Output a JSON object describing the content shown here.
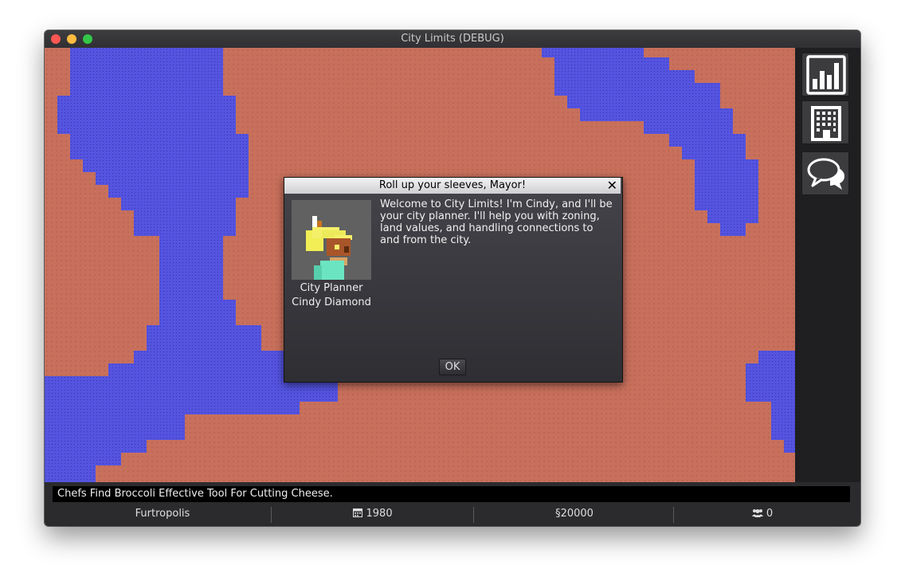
{
  "window": {
    "title": "City Limits (DEBUG)"
  },
  "news_ticker": "Chefs Find Broccoli Effective Tool For Cutting Cheese.",
  "status_bar": {
    "city_name": "Furtropolis",
    "year": "1980",
    "funds": "§20000",
    "population": "0"
  },
  "side_panel": {
    "buttons": [
      "statistics-icon",
      "building-icon",
      "chat-icon"
    ]
  },
  "dialog": {
    "title": "Roll up your sleeves, Mayor!",
    "speaker_role": "City Planner",
    "speaker_name": "Cindy Diamond",
    "message": "Welcome to City Limits! I'm Cindy, and I'll be your city planner. I'll help you with zoning, land values, and handling connections to and from the city.",
    "ok_label": "OK"
  },
  "colors": {
    "land": "#c8705c",
    "water": "#5454e0",
    "panel": "#1f1f21",
    "window": "#2b2b2d"
  }
}
